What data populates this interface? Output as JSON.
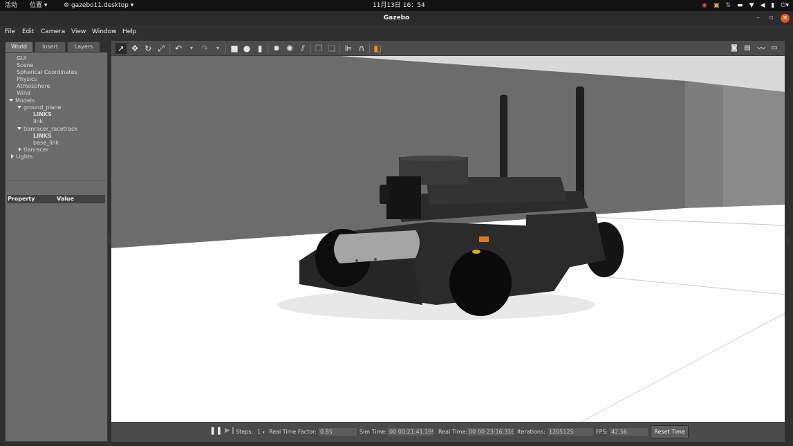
{
  "topbar": {
    "activities": "活动",
    "places": "位置",
    "app": "gazebo11.desktop",
    "clock": "11月13日 16：54",
    "tray_icons": [
      "settings-icon",
      "lock-icon",
      "network-tray-icon",
      "battery-icon",
      "wifi-icon",
      "volume-icon",
      "microphone-icon",
      "power-icon"
    ]
  },
  "window": {
    "title": "Gazebo",
    "minimize": "–",
    "maximize": "▫",
    "close": "×"
  },
  "menu": [
    "File",
    "Edit",
    "Camera",
    "View",
    "Window",
    "Help"
  ],
  "left_panel": {
    "tabs": [
      "World",
      "Insert",
      "Layers"
    ],
    "active_tab": "World",
    "tree": {
      "gui": "GUI",
      "scene": "Scene",
      "spherical": "Spherical Coordinates",
      "physics": "Physics",
      "atmosphere": "Atmosphere",
      "wind": "Wind",
      "models": "Models",
      "ground_plane": "ground_plane",
      "gp_links": "LINKS",
      "gp_link": "link",
      "racetrack": "tianracer_racetrack",
      "rt_links": "LINKS",
      "rt_base_link": "base_link",
      "tianracer": "tianracer",
      "lights": "Lights"
    },
    "property_header": {
      "property": "Property",
      "value": "Value"
    }
  },
  "toolbar_icons": [
    "select-mode-icon",
    "translate-icon",
    "rotate-icon",
    "scale-icon",
    "undo-icon",
    "undo-dropdown-icon",
    "redo-icon",
    "redo-dropdown-icon",
    "box-icon",
    "sphere-icon",
    "cylinder-icon",
    "point-light-icon",
    "spot-light-icon",
    "directional-light-icon",
    "copy-icon",
    "paste-icon",
    "align-icon",
    "snap-icon",
    "change-view-icon",
    "screenshot-icon",
    "log-icon",
    "plot-icon",
    "video-icon"
  ],
  "statusbar": {
    "pause_icon": "pause-icon",
    "step_icon": "step-icon",
    "steps_label": "Steps:",
    "steps_value": "1",
    "rtf_label": "Real Time Factor:",
    "rtf_value": "0.85",
    "sim_time_label": "Sim Time:",
    "sim_time_value": "00 00:21:41.199",
    "real_time_label": "Real Time:",
    "real_time_value": "00 00:23:16.316",
    "iterations_label": "Iterations:",
    "iterations_value": "1205125",
    "fps_label": "FPS:",
    "fps_value": "42.56",
    "reset_label": "Reset Time"
  },
  "colors": {
    "accent_orange": "#e9541f",
    "panel_bg": "#6b6b6b",
    "viewport_floor": "#ffffff",
    "viewport_wall": "#6e6e6e"
  }
}
